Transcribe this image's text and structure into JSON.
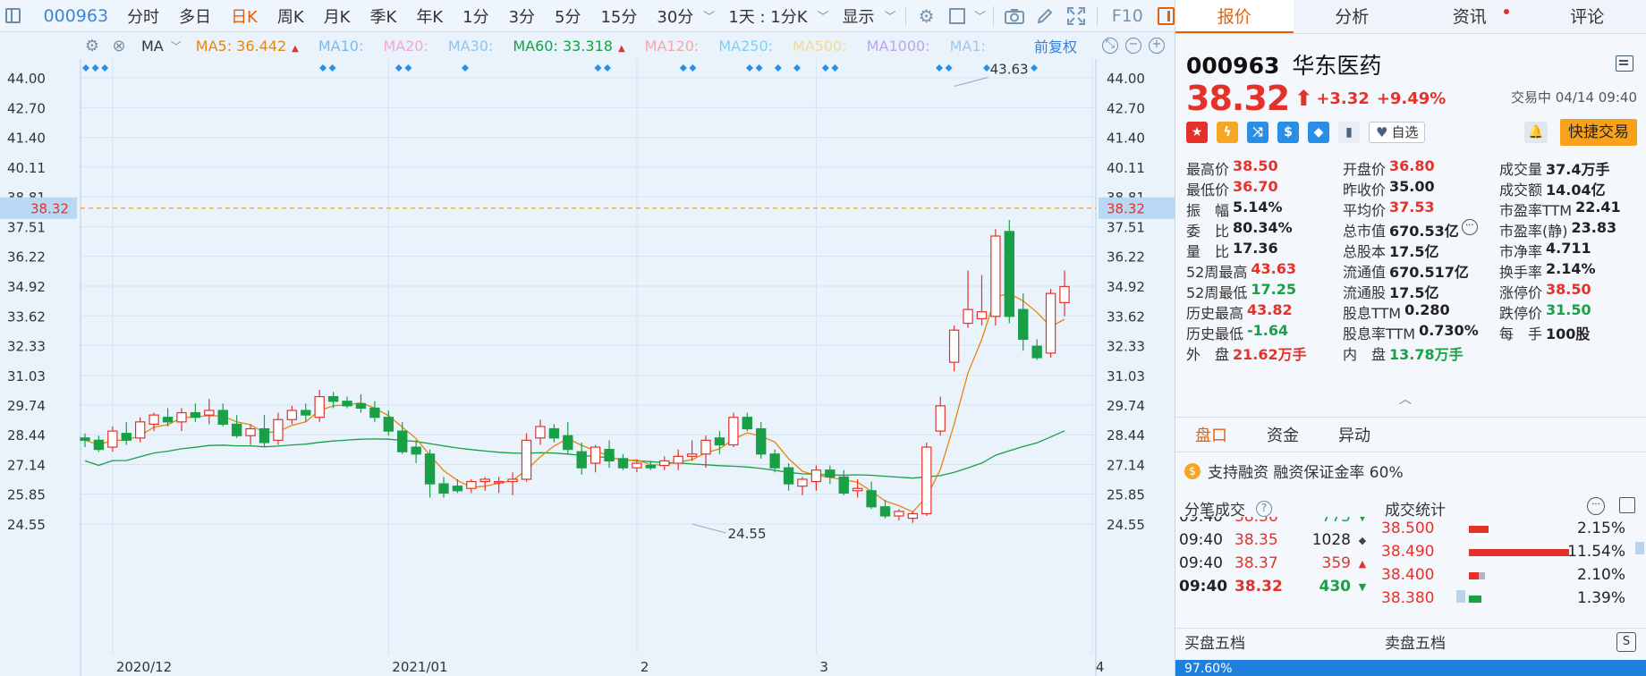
{
  "toolbar": {
    "code": "000963",
    "items": [
      "分时",
      "多日",
      "日K",
      "周K",
      "月K",
      "季K",
      "年K",
      "1分",
      "3分",
      "5分",
      "15分",
      "30分",
      "﹀",
      "1天 : 1分K",
      "﹀",
      "显示",
      "﹀"
    ],
    "active_item": "日K",
    "f10": "F10"
  },
  "ma_bar": {
    "label": "MA",
    "items": [
      {
        "text": "MA5: 36.442",
        "color": "#e8850c",
        "arrow": "▲"
      },
      {
        "text": "MA10:",
        "color": "#7fb8e8",
        "arrow": ""
      },
      {
        "text": "MA20:",
        "color": "#f2a7d0",
        "arrow": ""
      },
      {
        "text": "MA30:",
        "color": "#90c4ee",
        "arrow": ""
      },
      {
        "text": "MA60: 33.318",
        "color": "#19a046",
        "arrow": "▲"
      },
      {
        "text": "MA120:",
        "color": "#f4a9a9",
        "arrow": ""
      },
      {
        "text": "MA250:",
        "color": "#7fd3f0",
        "arrow": ""
      },
      {
        "text": "MA500:",
        "color": "#f0dc8c",
        "arrow": ""
      },
      {
        "text": "MA1000:",
        "color": "#b7a7e8",
        "arrow": ""
      },
      {
        "text": "MA1:",
        "color": "#9fc7ea",
        "arrow": ""
      }
    ],
    "adjust": "前复权"
  },
  "chart_data": {
    "type": "candlestick",
    "ylim": [
      24.0,
      44.5
    ],
    "yticks": [
      "44.00",
      "42.70",
      "41.40",
      "40.11",
      "38.81",
      "37.51",
      "36.22",
      "34.92",
      "33.62",
      "32.33",
      "31.03",
      "29.74",
      "28.44",
      "27.14",
      "25.85",
      "24.55"
    ],
    "current_price": "38.32",
    "x_labels": [
      {
        "label": "2020/12",
        "index": 2
      },
      {
        "label": "2021/01",
        "index": 22
      },
      {
        "label": "2",
        "index": 40
      },
      {
        "label": "3",
        "index": 53
      },
      {
        "label": "4",
        "index": 73
      }
    ],
    "annotations": [
      {
        "label": "43.63",
        "index": 63,
        "value": 43.63
      },
      {
        "label": "24.55",
        "index": 44,
        "value": 24.55
      }
    ],
    "candles": [
      [
        28.3,
        28.5,
        27.9,
        28.2
      ],
      [
        28.2,
        28.4,
        27.7,
        27.8
      ],
      [
        27.9,
        28.8,
        27.7,
        28.6
      ],
      [
        28.5,
        29.0,
        28.0,
        28.2
      ],
      [
        28.3,
        29.2,
        28.1,
        29.0
      ],
      [
        28.9,
        29.4,
        28.6,
        29.3
      ],
      [
        29.2,
        29.6,
        28.8,
        29.0
      ],
      [
        29.0,
        29.6,
        28.6,
        29.4
      ],
      [
        29.4,
        29.8,
        29.0,
        29.2
      ],
      [
        29.3,
        30.0,
        28.9,
        29.5
      ],
      [
        29.5,
        29.8,
        28.8,
        28.9
      ],
      [
        28.9,
        29.3,
        28.3,
        28.4
      ],
      [
        28.4,
        28.9,
        28.0,
        28.7
      ],
      [
        28.7,
        29.3,
        27.9,
        28.1
      ],
      [
        28.2,
        29.4,
        28.0,
        29.1
      ],
      [
        29.1,
        29.7,
        28.9,
        29.5
      ],
      [
        29.5,
        29.8,
        29.0,
        29.3
      ],
      [
        29.2,
        30.4,
        29.0,
        30.1
      ],
      [
        30.1,
        30.3,
        29.6,
        29.9
      ],
      [
        29.9,
        30.1,
        29.6,
        29.7
      ],
      [
        29.8,
        30.2,
        29.4,
        29.6
      ],
      [
        29.6,
        29.9,
        29.0,
        29.2
      ],
      [
        29.2,
        29.5,
        28.4,
        28.6
      ],
      [
        28.6,
        29.0,
        27.6,
        27.7
      ],
      [
        27.9,
        28.2,
        27.2,
        27.6
      ],
      [
        27.6,
        27.8,
        25.7,
        26.3
      ],
      [
        26.3,
        26.6,
        25.7,
        25.9
      ],
      [
        26.2,
        26.5,
        25.9,
        26.0
      ],
      [
        26.1,
        26.5,
        25.9,
        26.4
      ],
      [
        26.4,
        26.6,
        26.0,
        26.5
      ],
      [
        26.4,
        26.6,
        25.9,
        26.4
      ],
      [
        26.4,
        26.8,
        25.8,
        26.5
      ],
      [
        26.5,
        28.5,
        26.4,
        28.2
      ],
      [
        28.3,
        29.1,
        28.0,
        28.8
      ],
      [
        28.7,
        28.9,
        28.1,
        28.3
      ],
      [
        28.4,
        29.0,
        27.6,
        27.8
      ],
      [
        27.7,
        28.1,
        26.7,
        27.0
      ],
      [
        27.2,
        28.0,
        26.8,
        27.9
      ],
      [
        27.8,
        28.2,
        27.0,
        27.3
      ],
      [
        27.4,
        27.6,
        26.9,
        27.0
      ],
      [
        27.0,
        27.3,
        26.8,
        27.2
      ],
      [
        27.1,
        27.3,
        26.9,
        27.0
      ],
      [
        27.1,
        27.5,
        26.9,
        27.3
      ],
      [
        27.2,
        27.8,
        26.9,
        27.5
      ],
      [
        27.5,
        28.2,
        27.3,
        27.6
      ],
      [
        27.6,
        28.4,
        27.0,
        28.2
      ],
      [
        28.3,
        28.6,
        27.6,
        28.0
      ],
      [
        28.0,
        29.4,
        27.9,
        29.2
      ],
      [
        29.2,
        29.4,
        28.6,
        28.7
      ],
      [
        28.7,
        29.0,
        27.4,
        27.6
      ],
      [
        27.6,
        27.8,
        26.8,
        27.0
      ],
      [
        27.0,
        27.2,
        26.0,
        26.3
      ],
      [
        26.2,
        26.6,
        25.8,
        26.5
      ],
      [
        26.4,
        27.1,
        26.0,
        26.9
      ],
      [
        26.9,
        27.1,
        26.3,
        26.6
      ],
      [
        26.6,
        26.9,
        25.8,
        25.9
      ],
      [
        26.0,
        26.5,
        25.7,
        26.1
      ],
      [
        26.0,
        26.4,
        25.2,
        25.3
      ],
      [
        25.3,
        25.6,
        24.8,
        24.9
      ],
      [
        24.9,
        25.2,
        24.7,
        25.1
      ],
      [
        24.8,
        25.1,
        24.6,
        25.0
      ],
      [
        25.0,
        28.1,
        24.9,
        27.9
      ],
      [
        28.6,
        30.1,
        28.4,
        29.7
      ],
      [
        31.6,
        33.2,
        31.2,
        33.0
      ],
      [
        33.3,
        35.6,
        33.1,
        33.9
      ],
      [
        33.5,
        35.4,
        33.2,
        33.8
      ],
      [
        33.6,
        37.4,
        33.2,
        37.1
      ],
      [
        37.3,
        37.8,
        33.3,
        33.6
      ],
      [
        33.9,
        34.6,
        32.1,
        32.6
      ],
      [
        32.3,
        32.6,
        31.7,
        31.8
      ],
      [
        32.0,
        34.8,
        31.8,
        34.6
      ],
      [
        34.2,
        35.6,
        33.6,
        34.9
      ]
    ],
    "legend_note": "daily K-line, 000963"
  },
  "panel": {
    "tabs": [
      "报价",
      "分析",
      "资讯",
      "评论"
    ],
    "active_tab": "报价",
    "code": "000963",
    "name": "华东医药",
    "price": "38.32",
    "arrow": "⬆",
    "change": "+3.32",
    "change_pct": "+9.49%",
    "trade_time": "交易中 04/14 09:40",
    "zixuan": "自选",
    "quick_trade": "快捷交易",
    "quote": [
      [
        {
          "l": "最高价",
          "v": "38.50",
          "c": "red"
        },
        {
          "l": "开盘价",
          "v": "36.80",
          "c": "red"
        },
        {
          "l": "成交量",
          "v": "37.4万手",
          "c": "dark"
        }
      ],
      [
        {
          "l": "最低价",
          "v": "36.70",
          "c": "red"
        },
        {
          "l": "昨收价",
          "v": "35.00",
          "c": "dark"
        },
        {
          "l": "成交额",
          "v": "14.04亿",
          "c": "dark"
        }
      ],
      [
        {
          "l": "振　幅",
          "v": "5.14%",
          "c": "dark"
        },
        {
          "l": "平均价",
          "v": "37.53",
          "c": "red"
        },
        {
          "l": "市盈率TTM",
          "v": "22.41",
          "c": "dark"
        }
      ],
      [
        {
          "l": "委　比",
          "v": "80.34%",
          "c": "dark"
        },
        {
          "l": "总市值",
          "v": "670.53亿",
          "c": "dark",
          "more": true
        },
        {
          "l": "市盈率(静)",
          "v": "23.83",
          "c": "dark"
        }
      ],
      [
        {
          "l": "量　比",
          "v": "17.36",
          "c": "dark"
        },
        {
          "l": "总股本",
          "v": "17.5亿",
          "c": "dark"
        },
        {
          "l": "市净率",
          "v": "4.711",
          "c": "dark"
        }
      ],
      [
        {
          "l": "52周最高",
          "v": "43.63",
          "c": "red"
        },
        {
          "l": "流通值",
          "v": "670.517亿",
          "c": "dark"
        },
        {
          "l": "换手率",
          "v": "2.14%",
          "c": "dark"
        }
      ],
      [
        {
          "l": "52周最低",
          "v": "17.25",
          "c": "green"
        },
        {
          "l": "流通股",
          "v": "17.5亿",
          "c": "dark"
        },
        {
          "l": "涨停价",
          "v": "38.50",
          "c": "red"
        }
      ],
      [
        {
          "l": "历史最高",
          "v": "43.82",
          "c": "red"
        },
        {
          "l": "股息TTM",
          "v": "0.280",
          "c": "dark"
        },
        {
          "l": "跌停价",
          "v": "31.50",
          "c": "green"
        }
      ],
      [
        {
          "l": "历史最低",
          "v": "-1.64",
          "c": "green"
        },
        {
          "l": "股息率TTM",
          "v": "0.730%",
          "c": "dark"
        },
        {
          "l": "每　手",
          "v": "100股",
          "c": "dark"
        }
      ],
      [
        {
          "l": "外　盘",
          "v": "21.62万手",
          "c": "red"
        },
        {
          "l": "内　盘",
          "v": "13.78万手",
          "c": "green"
        },
        {
          "l": "",
          "v": "",
          "c": "dark"
        }
      ]
    ],
    "sub_tabs": [
      "盘口",
      "资金",
      "异动"
    ],
    "active_sub_tab": "盘口",
    "margin_text": "支持融资 融资保证金率 60%",
    "ticks_title": "分笔成交",
    "stats_title": "成交统计",
    "ticks": [
      {
        "t": "09:40",
        "p": "38.36",
        "v": "775",
        "dir": "down"
      },
      {
        "t": "09:40",
        "p": "38.35",
        "v": "1028",
        "dir": "flat"
      },
      {
        "t": "09:40",
        "p": "38.37",
        "v": "359",
        "dir": "up"
      },
      {
        "t": "09:40",
        "p": "38.32",
        "v": "430",
        "dir": "down"
      }
    ],
    "stats": [
      {
        "p": "38.500",
        "pct": "2.15%",
        "bar": 0.12,
        "type": "red"
      },
      {
        "p": "38.490",
        "pct": "11.54%",
        "bar": 0.62,
        "type": "red"
      },
      {
        "p": "38.400",
        "pct": "2.10%",
        "bar": 0.1,
        "type": "mixed"
      },
      {
        "p": "38.380",
        "pct": "1.39%",
        "bar": 0.08,
        "type": "green"
      }
    ],
    "buy_five": "买盘五档",
    "sell_five": "卖盘五档",
    "bottom_pct": "97.60%"
  }
}
